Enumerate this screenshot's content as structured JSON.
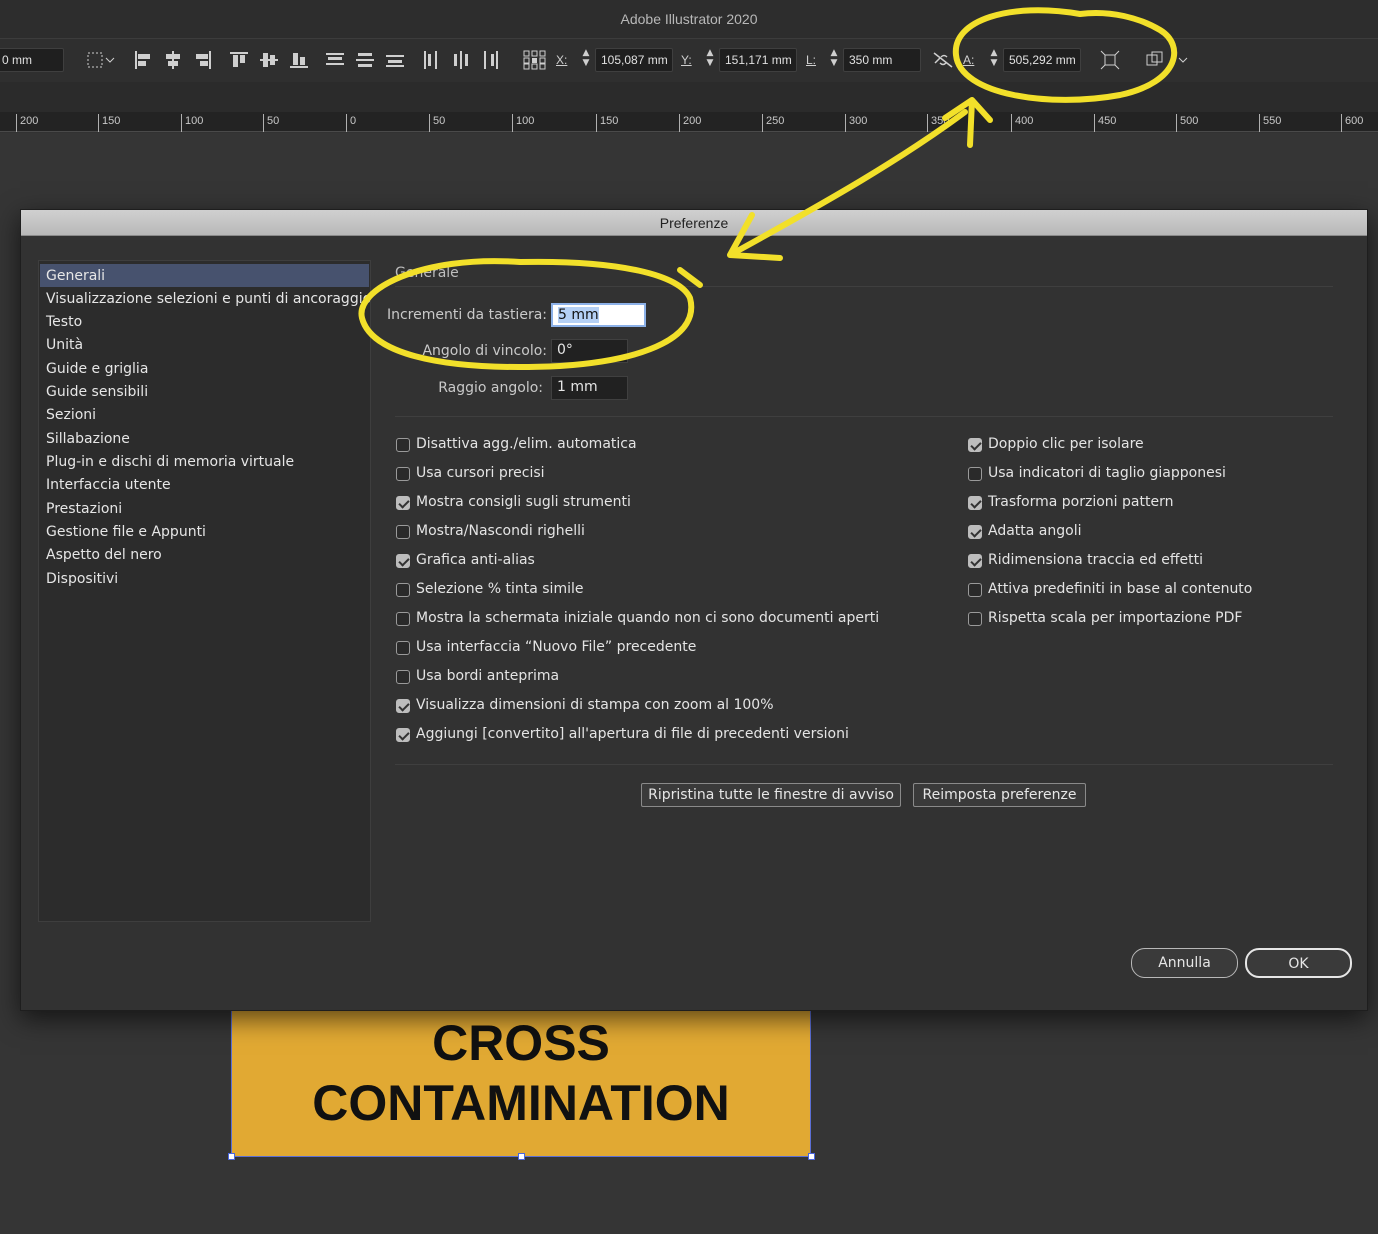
{
  "app": {
    "title": "Adobe Illustrator 2020"
  },
  "controlbar": {
    "stroke_value": "0 mm",
    "x_label": "X:",
    "x_value": "105,087 mm",
    "y_label": "Y:",
    "y_value": "151,171 mm",
    "w_label": "L:",
    "w_value": "350 mm",
    "h_label": "A:",
    "h_value": "505,292 mm"
  },
  "ruler": {
    "ticks": [
      "200",
      "150",
      "100",
      "50",
      "0",
      "50",
      "100",
      "150",
      "200",
      "250",
      "300",
      "350",
      "400",
      "450",
      "500",
      "550",
      "600"
    ]
  },
  "artwork": {
    "line1": "CROSS",
    "line2": "CONTAMINATION",
    "fill": "#e1a933"
  },
  "dialog": {
    "title": "Preferenze",
    "sidebar": [
      "Generali",
      "Visualizzazione selezioni e punti di ancoraggio",
      "Testo",
      "Unità",
      "Guide e griglia",
      "Guide sensibili",
      "Sezioni",
      "Sillabazione",
      "Plug-in e dischi di memoria virtuale",
      "Interfaccia utente",
      "Prestazioni",
      "Gestione file e Appunti",
      "Aspetto del nero",
      "Dispositivi"
    ],
    "selected_section": "Generali",
    "section_heading": "Generale",
    "fields": {
      "keyboard_increment_label": "Incrementi da tastiera:",
      "keyboard_increment_value": "5 mm",
      "constrain_angle_label": "Angolo di vincolo:",
      "constrain_angle_value": "0°",
      "corner_radius_label": "Raggio angolo:",
      "corner_radius_value": "1 mm"
    },
    "checkboxes_left": [
      {
        "label": "Disattiva agg./elim. automatica",
        "checked": false
      },
      {
        "label": "Usa cursori precisi",
        "checked": false
      },
      {
        "label": "Mostra consigli sugli strumenti",
        "checked": true
      },
      {
        "label": "Mostra/Nascondi righelli",
        "checked": false
      },
      {
        "label": "Grafica anti-alias",
        "checked": true
      },
      {
        "label": "Selezione % tinta simile",
        "checked": false
      },
      {
        "label": "Mostra la schermata iniziale quando non ci sono documenti aperti",
        "checked": false
      },
      {
        "label": "Usa interfaccia “Nuovo File” precedente",
        "checked": false
      },
      {
        "label": "Usa bordi anteprima",
        "checked": false
      },
      {
        "label": "Visualizza dimensioni di stampa con zoom al 100%",
        "checked": true
      },
      {
        "label": "Aggiungi [convertito] all'apertura di file di precedenti versioni",
        "checked": true
      }
    ],
    "checkboxes_right": [
      {
        "label": "Doppio clic per isolare",
        "checked": true
      },
      {
        "label": "Usa indicatori di taglio giapponesi",
        "checked": false
      },
      {
        "label": "Trasforma porzioni pattern",
        "checked": true
      },
      {
        "label": "Adatta angoli",
        "checked": true
      },
      {
        "label": "Ridimensiona traccia ed effetti",
        "checked": true
      },
      {
        "label": "Attiva predefiniti in base al contenuto",
        "checked": false
      },
      {
        "label": "Rispetta scala per importazione PDF",
        "checked": false
      }
    ],
    "buttons": {
      "reset_warnings": "Ripristina tutte le finestre di avviso",
      "reset_prefs": "Reimposta preferenze",
      "cancel": "Annulla",
      "ok": "OK"
    }
  },
  "colors": {
    "annotation": "#f2e02a",
    "selection": "#47526e",
    "accent_focus": "#8cb1e8"
  }
}
